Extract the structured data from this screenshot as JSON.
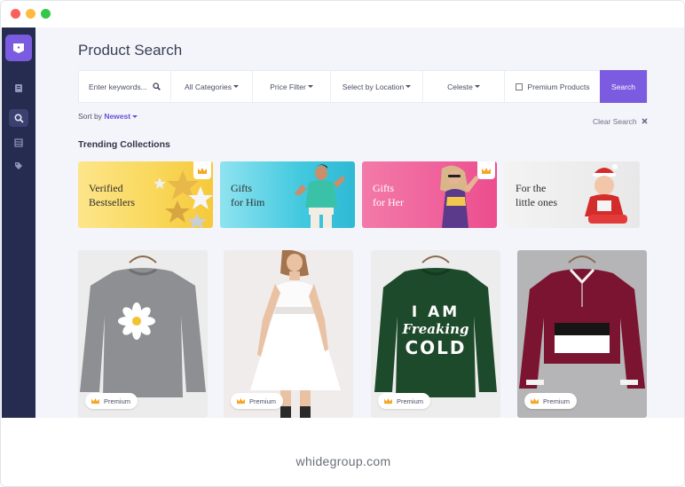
{
  "window": {
    "traffic_lights": [
      "close",
      "minimize",
      "maximize"
    ]
  },
  "colors": {
    "accent": "#7b5be0",
    "sidebar": "#262c4f",
    "background": "#f4f5fa"
  },
  "sidebar": {
    "items": [
      {
        "icon": "document-icon"
      },
      {
        "icon": "search-icon",
        "active": true
      },
      {
        "icon": "list-icon"
      },
      {
        "icon": "tag-icon"
      }
    ]
  },
  "page": {
    "title": "Product Search"
  },
  "search": {
    "placeholder": "Enter keywords...",
    "categories": "All Categories",
    "price": "Price Filter",
    "location": "Select by Location",
    "user": "Celeste",
    "premium_label": "Premium Products",
    "button": "Search"
  },
  "sort": {
    "prefix": "Sort by",
    "value": "Newest"
  },
  "clear_label": "Clear Search",
  "trending": {
    "heading": "Trending Collections",
    "items": [
      {
        "line1": "Verified",
        "line2": "Bestsellers",
        "premium": true
      },
      {
        "line1": "Gifts",
        "line2": "for Him",
        "premium": false
      },
      {
        "line1": "Gifts",
        "line2": "for Her",
        "premium": true
      },
      {
        "line1": "For the",
        "line2": "little ones",
        "premium": false
      }
    ]
  },
  "products": [
    {
      "name": "Grey daisy sweater",
      "badge": "Premium"
    },
    {
      "name": "White summer dress",
      "badge": "Premium"
    },
    {
      "name": "I am freaking cold sweatshirt",
      "badge": "Premium",
      "print": [
        "I AM",
        "Freaking",
        "COLD"
      ]
    },
    {
      "name": "Burgundy zip pullover",
      "badge": "Premium"
    }
  ],
  "footer": {
    "site": "whidegroup.com"
  }
}
